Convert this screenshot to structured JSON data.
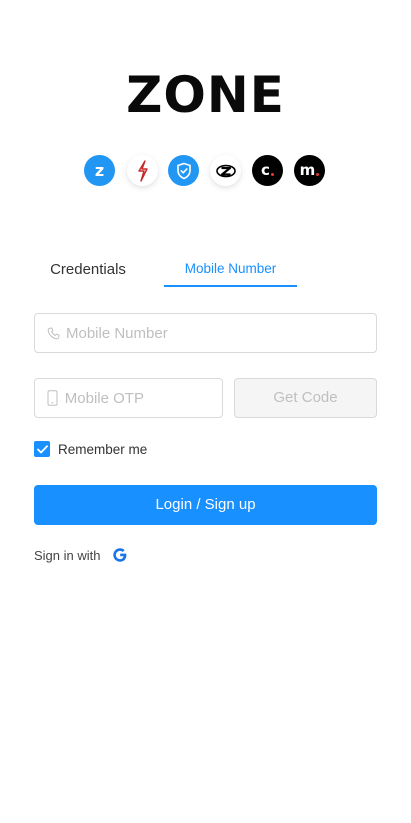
{
  "logo": {
    "text": "ZONE"
  },
  "apps": [
    {
      "icon": "zone-z-icon",
      "letter": "z",
      "bg": "#2196f3"
    },
    {
      "icon": "red-lightning-icon",
      "bg": "#ffffff"
    },
    {
      "icon": "blue-shield-icon",
      "bg": "#2196f3"
    },
    {
      "icon": "black-z-logo-icon",
      "bg": "#ffffff"
    },
    {
      "icon": "c-dot-icon",
      "letter": "c",
      "bg": "#000000"
    },
    {
      "icon": "m-dot-icon",
      "letter": "m",
      "bg": "#000000"
    }
  ],
  "tabs": [
    {
      "label": "Credentials",
      "active": false
    },
    {
      "label": "Mobile Number",
      "active": true
    }
  ],
  "form": {
    "mobile_placeholder": "Mobile Number",
    "otp_placeholder": "Mobile OTP",
    "get_code_label": "Get Code",
    "remember_label": "Remember me",
    "remember_checked": true,
    "login_label": "Login / Sign up",
    "signin_with_label": "Sign in with"
  },
  "colors": {
    "accent": "#1890ff",
    "border": "#d9d9d9",
    "disabled_bg": "#f5f5f5",
    "placeholder": "#bfbfbf",
    "google_blue": "#1a73e8"
  }
}
